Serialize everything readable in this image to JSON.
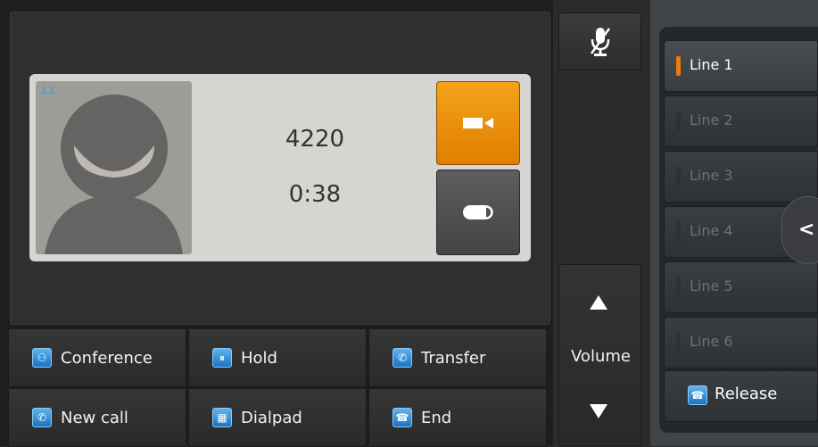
{
  "call": {
    "line_tag": "L1",
    "number": "4220",
    "duration": "0:38"
  },
  "softkeys": [
    {
      "label": "Conference",
      "icon": "conference-icon"
    },
    {
      "label": "Hold",
      "icon": "hold-icon"
    },
    {
      "label": "Transfer",
      "icon": "transfer-icon"
    },
    {
      "label": "New call",
      "icon": "new-call-icon"
    },
    {
      "label": "Dialpad",
      "icon": "dialpad-icon"
    },
    {
      "label": "End",
      "icon": "end-call-icon"
    }
  ],
  "volume": {
    "label": "Volume"
  },
  "lines": [
    {
      "label": "Line 1",
      "active": true
    },
    {
      "label": "Line 2",
      "active": false
    },
    {
      "label": "Line 3",
      "active": false
    },
    {
      "label": "Line 4",
      "active": false
    },
    {
      "label": "Line 5",
      "active": false
    },
    {
      "label": "Line 6",
      "active": false
    }
  ],
  "release": {
    "label": "Release",
    "icon": "release-icon"
  },
  "colors": {
    "accent_orange": "#f07a10",
    "icon_blue": "#1a73c4",
    "card_bg": "#d7d5d1"
  }
}
